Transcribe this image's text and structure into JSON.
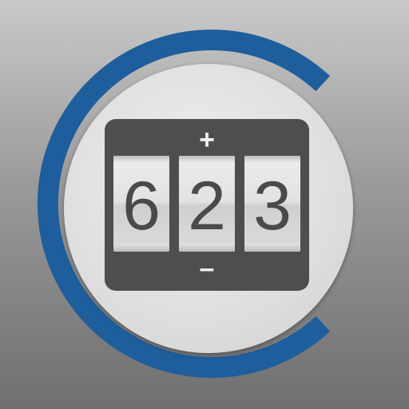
{
  "counter": {
    "increment_symbol": "+",
    "decrement_symbol": "–",
    "digits": [
      "6",
      "2",
      "3"
    ]
  },
  "colors": {
    "ring_accent": "#1f5e9c",
    "panel": "#4d4e50",
    "disc": "#e3e3e3"
  }
}
